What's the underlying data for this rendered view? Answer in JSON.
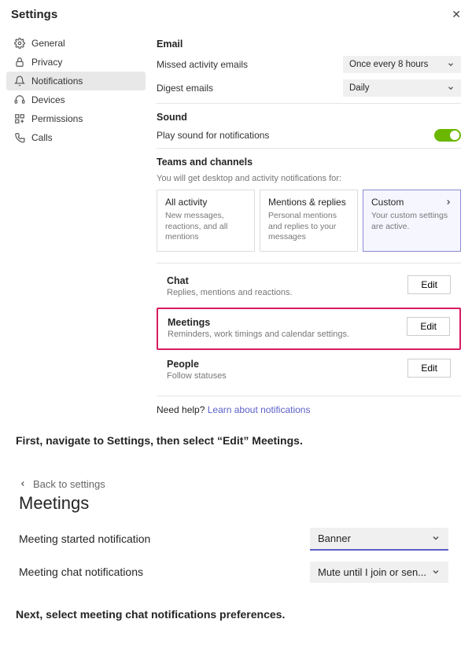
{
  "dialog": {
    "title": "Settings",
    "close": "✕"
  },
  "sidebar": {
    "items": [
      {
        "label": "General"
      },
      {
        "label": "Privacy"
      },
      {
        "label": "Notifications"
      },
      {
        "label": "Devices"
      },
      {
        "label": "Permissions"
      },
      {
        "label": "Calls"
      }
    ]
  },
  "email": {
    "heading": "Email",
    "missed_label": "Missed activity emails",
    "missed_value": "Once every 8 hours",
    "digest_label": "Digest emails",
    "digest_value": "Daily"
  },
  "sound": {
    "heading": "Sound",
    "play_label": "Play sound for notifications"
  },
  "tc": {
    "heading": "Teams and channels",
    "sub": "You will get desktop and activity notifications for:",
    "cards": [
      {
        "title": "All activity",
        "sub": "New messages, reactions, and all mentions"
      },
      {
        "title": "Mentions & replies",
        "sub": "Personal mentions and replies to your messages"
      },
      {
        "title": "Custom",
        "sub": "Your custom settings are active."
      }
    ]
  },
  "blocks": {
    "chat": {
      "title": "Chat",
      "sub": "Replies, mentions and reactions.",
      "btn": "Edit"
    },
    "meetings": {
      "title": "Meetings",
      "sub": "Reminders, work timings and calendar settings.",
      "btn": "Edit"
    },
    "people": {
      "title": "People",
      "sub": "Follow statuses",
      "btn": "Edit"
    }
  },
  "help": {
    "prefix": "Need help? ",
    "link": "Learn about notifications"
  },
  "step1": "First, navigate to Settings, then select “Edit” Meetings.",
  "panel2": {
    "back": "Back to settings",
    "title": "Meetings",
    "rows": [
      {
        "label": "Meeting started notification",
        "value": "Banner",
        "underlined": true
      },
      {
        "label": "Meeting chat notifications",
        "value": "Mute until I join or sen...",
        "underlined": false
      }
    ]
  },
  "step2": "Next, select meeting chat notifications preferences."
}
